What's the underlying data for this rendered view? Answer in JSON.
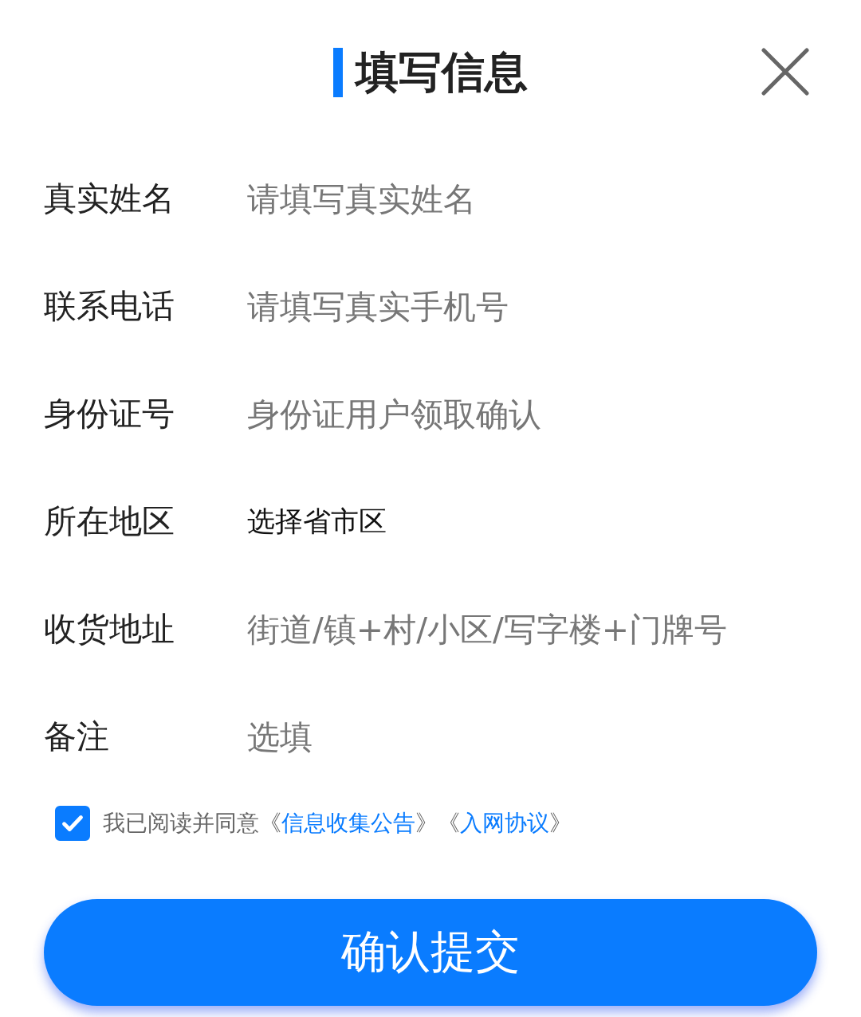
{
  "title": "填写信息",
  "fields": [
    {
      "label": "真实姓名",
      "kind": "input",
      "placeholder": "请填写真实姓名"
    },
    {
      "label": "联系电话",
      "kind": "input",
      "placeholder": "请填写真实手机号"
    },
    {
      "label": "身份证号",
      "kind": "input",
      "placeholder": "身份证用户领取确认"
    },
    {
      "label": "所在地区",
      "kind": "select",
      "value": "选择省市区"
    },
    {
      "label": "收货地址",
      "kind": "input",
      "placeholder": "街道/镇+村/小区/写字楼+门牌号"
    },
    {
      "label": "备注",
      "kind": "input",
      "placeholder": "选填"
    }
  ],
  "agreement": {
    "checked": true,
    "segments": [
      {
        "kind": "text",
        "text": "我已阅读并同意《"
      },
      {
        "kind": "link",
        "text": "信息收集公告"
      },
      {
        "kind": "text",
        "text": "》《"
      },
      {
        "kind": "link",
        "text": "入网协议"
      },
      {
        "kind": "text",
        "text": "》"
      }
    ]
  },
  "submit": "确认提交"
}
